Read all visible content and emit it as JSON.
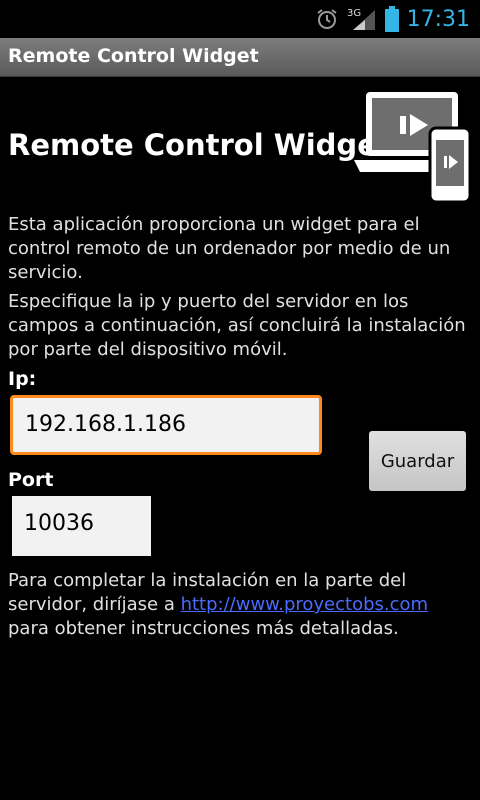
{
  "status": {
    "time": "17:31",
    "network": "3G"
  },
  "titlebar": {
    "title": "Remote Control Widget"
  },
  "main": {
    "heading": "Remote Control Widget",
    "intro": "Esta aplicación proporciona un widget para el control remoto de un ordenador por medio de un servicio.",
    "instructions": "Especifique la ip y puerto del servidor en los campos a continuación, así concluirá la instalación por parte del dispositivo móvil.",
    "ip_label": "Ip:",
    "ip_value": "192.168.1.186",
    "port_label": "Port",
    "port_value": "10036",
    "save_label": "Guardar",
    "footer_before": "Para completar la instalación en la parte del servidor, diríjase a ",
    "footer_link": "http://www.proyectobs.com",
    "footer_after": " para obtener instrucciones más detalladas."
  },
  "colors": {
    "accent": "#33b5e5",
    "focus": "#ff8a1c",
    "link": "#4a6bff"
  }
}
